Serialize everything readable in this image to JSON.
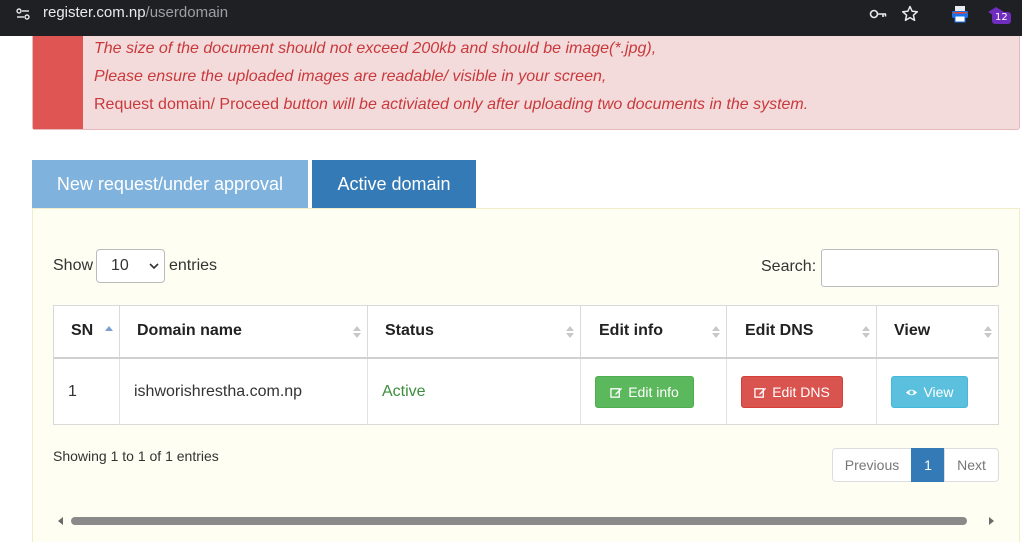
{
  "browser": {
    "url_domain": "register.com.np",
    "url_path": "/userdomain",
    "extension_badge": "12"
  },
  "alert": {
    "line1": "The size of the document should not exceed 200kb and should be image(*.jpg),",
    "line2": "Please ensure the uploaded images are readable/ visible in your screen,",
    "line3_strong": "Request domain/ Proceed",
    "line3_rest": " button will be activiated only after uploading two documents in the system."
  },
  "tabs": [
    {
      "label": "New request/under approval"
    },
    {
      "label": "Active domain",
      "active": true
    }
  ],
  "controls": {
    "show_label": "Show",
    "entries_value": "10",
    "entries_label": "entries",
    "search_label": "Search:",
    "search_value": ""
  },
  "table": {
    "columns": [
      "SN",
      "Domain name",
      "Status",
      "Edit info",
      "Edit DNS",
      "View"
    ],
    "rows": [
      {
        "sn": "1",
        "domain": "ishworishrestha.com.np",
        "status": "Active",
        "edit_info": "Edit info",
        "edit_dns": "Edit DNS",
        "view": "View"
      }
    ]
  },
  "footer": {
    "info": "Showing 1 to 1 of 1 entries",
    "previous": "Previous",
    "page": "1",
    "next": "Next"
  },
  "colors": {
    "status_active": "#3c8d3c",
    "primary": "#337ab7",
    "success": "#5cb85c",
    "danger": "#d9534f",
    "info": "#5bc0de"
  }
}
